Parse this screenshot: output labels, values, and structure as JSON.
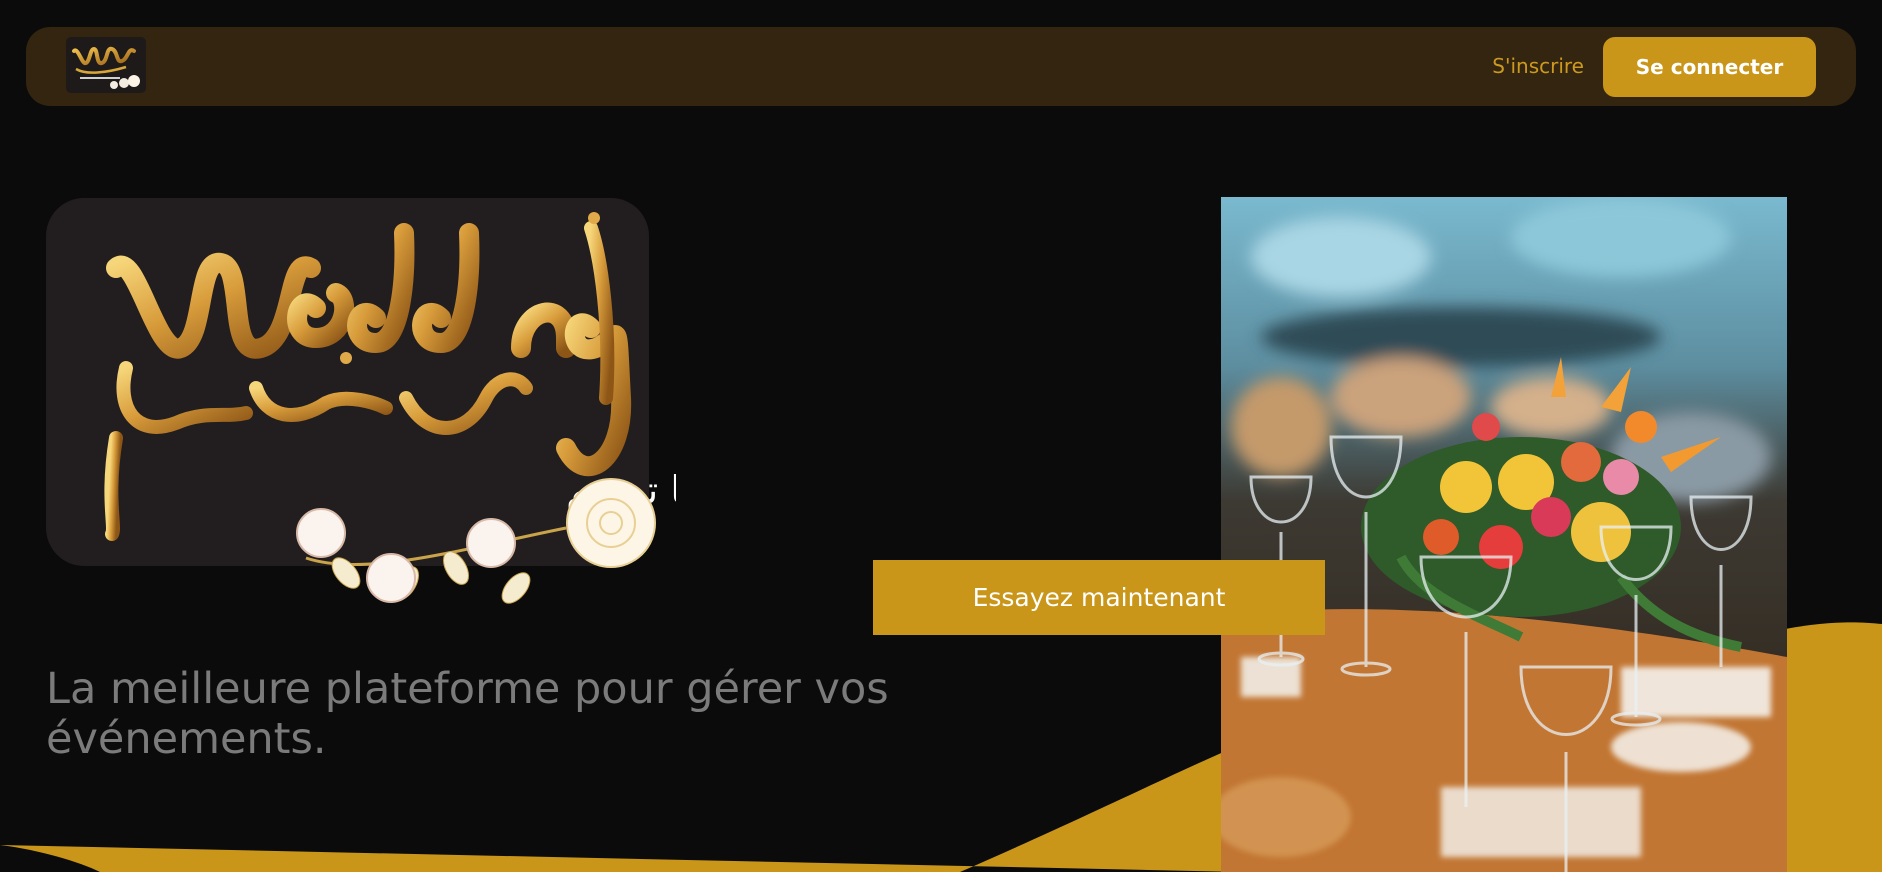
{
  "nav": {
    "signup_label": "S'inscrire",
    "login_label": "Se connecter"
  },
  "hero": {
    "logo_wordmark": "Wedding",
    "logo_arabic_name": "أعرس حلم",
    "logo_arabic_slogan": "تنظيم أفراحكم كما تمنيتم",
    "cta_label": "Essayez maintenant",
    "tagline": "La meilleure plateforme pour gérer vos événements."
  },
  "colors": {
    "background": "#0b0b0b",
    "nav_background": "#33250f",
    "accent_gold": "#c9961a",
    "tagline_gray": "#7b7b7b"
  },
  "icons": {
    "brand": "wedding-logo",
    "decoration": "white-roses"
  }
}
